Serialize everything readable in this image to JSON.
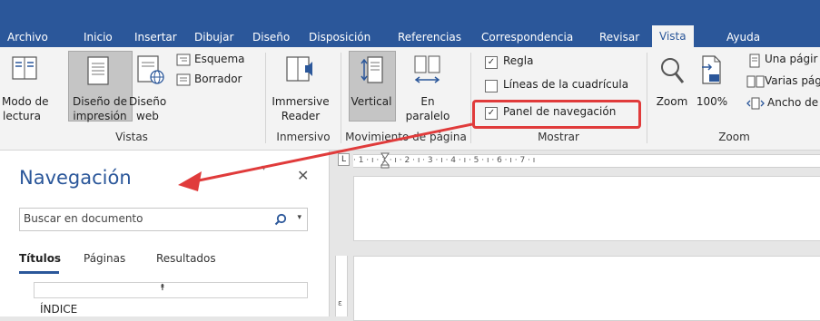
{
  "tabs": [
    {
      "label": "Archivo"
    },
    {
      "label": "Inicio"
    },
    {
      "label": "Insertar"
    },
    {
      "label": "Dibujar"
    },
    {
      "label": "Diseño"
    },
    {
      "label": "Disposición"
    },
    {
      "label": "Referencias"
    },
    {
      "label": "Correspondencia"
    },
    {
      "label": "Revisar"
    },
    {
      "label": "Vista"
    },
    {
      "label": "Ayuda"
    }
  ],
  "active_tab": "Vista",
  "ribbon": {
    "vistas": {
      "group_label": "Vistas",
      "modo_lectura_1": "Modo de",
      "modo_lectura_2": "lectura",
      "diseno_impresion_1": "Diseño de",
      "diseno_impresion_2": "impresión",
      "diseno_web_1": "Diseño",
      "diseno_web_2": "web",
      "esquema": "Esquema",
      "borrador": "Borrador"
    },
    "inmersivo": {
      "group_label": "Inmersivo",
      "immersive_1": "Immersive",
      "immersive_2": "Reader"
    },
    "movimiento": {
      "group_label": "Movimiento de página",
      "vertical": "Vertical",
      "en_paralelo_1": "En",
      "en_paralelo_2": "paralelo"
    },
    "mostrar": {
      "group_label": "Mostrar",
      "regla": "Regla",
      "lineas": "Líneas de la cuadrícula",
      "panel": "Panel de navegación",
      "regla_checked": true,
      "lineas_checked": false,
      "panel_checked": true
    },
    "zoom": {
      "group_label": "Zoom",
      "zoom": "Zoom",
      "percent": "100%",
      "una_pagina": "Una págir",
      "varias": "Varias pág",
      "ancho": "Ancho de"
    }
  },
  "navigation": {
    "title": "Navegación",
    "search_placeholder": "Buscar en documento",
    "tabs": [
      "Títulos",
      "Páginas",
      "Resultados"
    ],
    "active_tab": "Títulos",
    "first_heading": "ÍNDICE"
  },
  "ruler": {
    "corner": "L",
    "marks": "· 1 · ı · 1 · ı · 2 · ı · 3 · ı · 4 · ı · 5 · ı · 6 · ı · 7 · ı",
    "vertical_mark": "ε"
  },
  "colors": {
    "brand_blue": "#2b579a",
    "annotation_red": "#e03b3b"
  }
}
